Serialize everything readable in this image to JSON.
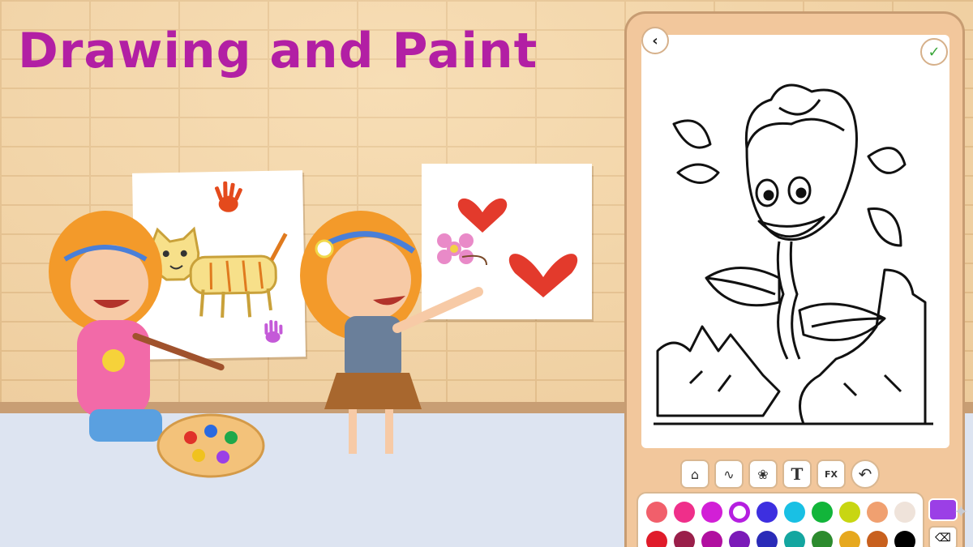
{
  "title": "Drawing and Paint",
  "colors": {
    "title": "#b21fa4",
    "wall": "#f3d4a6",
    "floor": "#dde4f1",
    "phone_frame": "#f2c79c",
    "done_check": "#3aa63a"
  },
  "phone": {
    "back_icon": "‹",
    "done_icon": "✓",
    "tools": [
      {
        "name": "fill-bucket-icon",
        "glyph": "⌂"
      },
      {
        "name": "brush-stroke-icon",
        "glyph": "∿"
      },
      {
        "name": "stamp-icon",
        "glyph": "❀"
      },
      {
        "name": "text-icon",
        "glyph": "T"
      },
      {
        "name": "effects-icon",
        "glyph": "FX"
      },
      {
        "name": "undo-icon",
        "glyph": "↶"
      }
    ],
    "palette_row1": [
      "#f15f6b",
      "#ef2f8a",
      "#d21fd6",
      "#ffffff",
      "#3d2fe0",
      "#19c0e4",
      "#12b53a",
      "#c8d612",
      "#f0a070",
      "#efe3da"
    ],
    "palette_row2": [
      "#e01b2a",
      "#9a1f4a",
      "#b10fa0",
      "#7b1ab8",
      "#2a2bb8",
      "#14a6a0",
      "#2c8b2e",
      "#e6a81e",
      "#c8601e",
      "#000000"
    ],
    "selected_swatch": "purple",
    "current_color": "#9b3fe6",
    "eraser_icon": "⌫"
  }
}
